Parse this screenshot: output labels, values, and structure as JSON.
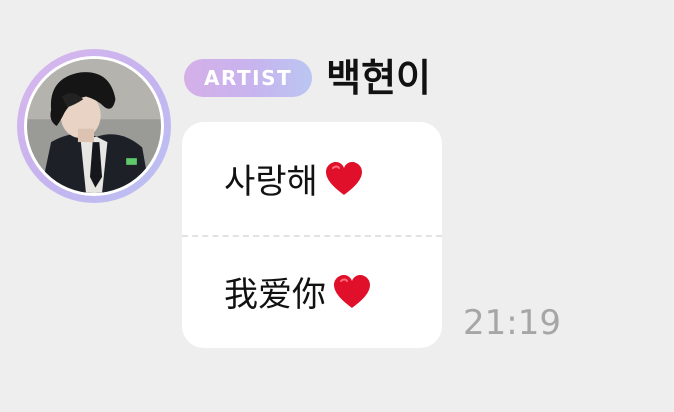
{
  "message": {
    "badge_label": "ARTIST",
    "sender_name": "백현이",
    "lines": [
      {
        "text": "사랑해",
        "emoji": "heart-icon"
      },
      {
        "text": "我爱你",
        "emoji": "heart-icon"
      }
    ],
    "time": "21:19"
  },
  "colors": {
    "background": "#eeeeee",
    "bubble": "#ffffff",
    "badge_gradient_start": "#d5afe8",
    "badge_gradient_end": "#bbc6f2",
    "heart": "#e0102a",
    "timestamp": "#a6a6a6"
  }
}
